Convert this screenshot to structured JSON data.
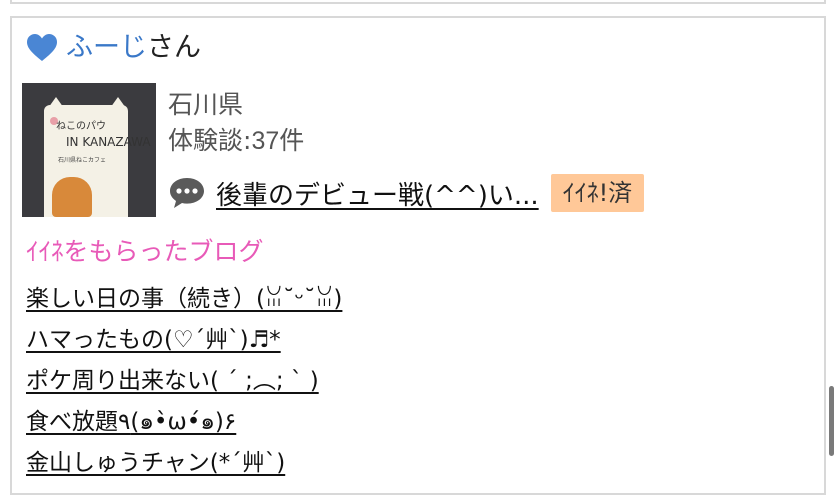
{
  "user": {
    "name": "ふーじ",
    "suffix": "さん",
    "prefecture": "石川県",
    "experience_label": "体験談:",
    "experience_count": "37件"
  },
  "thumbnail": {
    "title_small": "ねこのパウ",
    "title_big": "IN KANAZAWA",
    "subtitle": "石川県ねこカフェ"
  },
  "latest": {
    "link_text": "後輩のデビュー戦(^^)い...",
    "badge": "ｲｲﾈ!済"
  },
  "section": {
    "title": "ｲｲﾈをもらったブログ"
  },
  "blogs": [
    "楽しい日の事（続き）(ꈍ˘ᵕ˘ꈍ)",
    "ハマったもの(♡´艸`)♬*",
    "ポケ周り出来ない( ´ ;︵; ` )",
    "食べ放題٩(๑•̀ω•́๑)۶",
    "金山しゅうチャン(*´艸`)"
  ],
  "colors": {
    "username": "#3a78c8",
    "heart": "#4a86d4",
    "section_title": "#e85ab8",
    "badge_bg": "#ffc898"
  },
  "icons": {
    "heart": "heart-icon",
    "comment": "speech-bubble-icon"
  }
}
